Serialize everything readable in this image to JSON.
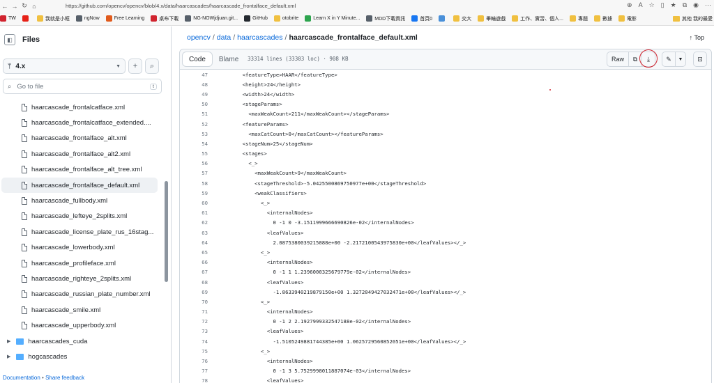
{
  "browser": {
    "url": "https://github.com/opencv/opencv/blob/4.x/data/haarcascades/haarcascade_frontalface_default.xml",
    "bookmarks": [
      {
        "label": "TW",
        "color": "#d1242f"
      },
      {
        "label": "",
        "color": "#e62117"
      },
      {
        "label": "我就是小框",
        "color": "#f0c040"
      },
      {
        "label": "ngNow",
        "color": "#57606a"
      },
      {
        "label": "Free Learning",
        "color": "#e05a1c"
      },
      {
        "label": "桌布下載",
        "color": "#d1242f"
      },
      {
        "label": "NG-NOWjdjuan.git...",
        "color": "#57606a"
      },
      {
        "label": "GitHub",
        "color": "#24292f"
      },
      {
        "label": "otobrite",
        "color": "#f0c040"
      },
      {
        "label": "Learn X in Y Minute...",
        "color": "#2da44e"
      },
      {
        "label": "MDD下載資訊",
        "color": "#57606a"
      },
      {
        "label": "首頁0",
        "color": "#1877f2"
      },
      {
        "label": "",
        "color": "#4a90d9"
      },
      {
        "label": "交大",
        "color": "#f0c040"
      },
      {
        "label": "畢輪遊戲",
        "color": "#f0c040"
      },
      {
        "label": "工作、實習、個人...",
        "color": "#f0c040"
      },
      {
        "label": "專題",
        "color": "#f0c040"
      },
      {
        "label": "數據",
        "color": "#f0c040"
      },
      {
        "label": "電影",
        "color": "#f0c040"
      }
    ],
    "other_bookmarks": "其他 我的最愛"
  },
  "sidebar": {
    "title": "Files",
    "branch": "4.x",
    "goto_placeholder": "Go to file",
    "goto_shortcut": "t",
    "files": [
      "haarcascade_frontalcatface.xml",
      "haarcascade_frontalcatface_extended....",
      "haarcascade_frontalface_alt.xml",
      "haarcascade_frontalface_alt2.xml",
      "haarcascade_frontalface_alt_tree.xml",
      "haarcascade_frontalface_default.xml",
      "haarcascade_fullbody.xml",
      "haarcascade_lefteye_2splits.xml",
      "haarcascade_license_plate_rus_16stag...",
      "haarcascade_lowerbody.xml",
      "haarcascade_profileface.xml",
      "haarcascade_righteye_2splits.xml",
      "haarcascade_russian_plate_number.xml",
      "haarcascade_smile.xml",
      "haarcascade_upperbody.xml"
    ],
    "selected_index": 5,
    "folders": [
      "haarcascades_cuda",
      "hogcascades"
    ],
    "footer_doc": "Documentation",
    "footer_sep": " • ",
    "footer_feedback": "Share feedback"
  },
  "breadcrumb": {
    "parts": [
      "opencv",
      "data",
      "haarcascades"
    ],
    "current": "haarcascade_frontalface_default.xml",
    "top_label": "Top"
  },
  "code_header": {
    "tab_code": "Code",
    "tab_blame": "Blame",
    "meta": "33314 lines (33303 loc) · 908 KB",
    "raw_label": "Raw"
  },
  "code_lines": [
    {
      "n": "47",
      "t": "    <featureType>HAAR</featureType>"
    },
    {
      "n": "48",
      "t": "    <height>24</height>"
    },
    {
      "n": "49",
      "t": "    <width>24</width>"
    },
    {
      "n": "50",
      "t": "    <stageParams>"
    },
    {
      "n": "51",
      "t": "      <maxWeakCount>211</maxWeakCount></stageParams>"
    },
    {
      "n": "52",
      "t": "    <featureParams>"
    },
    {
      "n": "53",
      "t": "      <maxCatCount>0</maxCatCount></featureParams>"
    },
    {
      "n": "54",
      "t": "    <stageNum>25</stageNum>"
    },
    {
      "n": "55",
      "t": "    <stages>"
    },
    {
      "n": "56",
      "t": "      <_>"
    },
    {
      "n": "57",
      "t": "        <maxWeakCount>9</maxWeakCount>"
    },
    {
      "n": "58",
      "t": "        <stageThreshold>-5.0425500869750977e+00</stageThreshold>"
    },
    {
      "n": "59",
      "t": "        <weakClassifiers>"
    },
    {
      "n": "60",
      "t": "          <_>"
    },
    {
      "n": "61",
      "t": "            <internalNodes>"
    },
    {
      "n": "62",
      "t": "              0 -1 0 -3.1511999666690826e-02</internalNodes>"
    },
    {
      "n": "63",
      "t": "            <leafValues>"
    },
    {
      "n": "64",
      "t": "              2.0875380039215088e+00 -2.2172100543975830e+00</leafValues></_>"
    },
    {
      "n": "65",
      "t": "          <_>"
    },
    {
      "n": "66",
      "t": "            <internalNodes>"
    },
    {
      "n": "67",
      "t": "              0 -1 1 1.2396000325679779e-02</internalNodes>"
    },
    {
      "n": "68",
      "t": "            <leafValues>"
    },
    {
      "n": "69",
      "t": "              -1.8633940219879150e+00 1.3272049427032471e+00</leafValues></_>"
    },
    {
      "n": "70",
      "t": "          <_>"
    },
    {
      "n": "71",
      "t": "            <internalNodes>"
    },
    {
      "n": "72",
      "t": "              0 -1 2 2.1927999332547188e-02</internalNodes>"
    },
    {
      "n": "73",
      "t": "            <leafValues>"
    },
    {
      "n": "74",
      "t": "              -1.5105249881744385e+00 1.0625729560852051e+00</leafValues></_>"
    },
    {
      "n": "75",
      "t": "          <_>"
    },
    {
      "n": "76",
      "t": "            <internalNodes>"
    },
    {
      "n": "77",
      "t": "              0 -1 3 5.7529998011887074e-03</internalNodes>"
    },
    {
      "n": "78",
      "t": "            <leafValues>"
    }
  ]
}
